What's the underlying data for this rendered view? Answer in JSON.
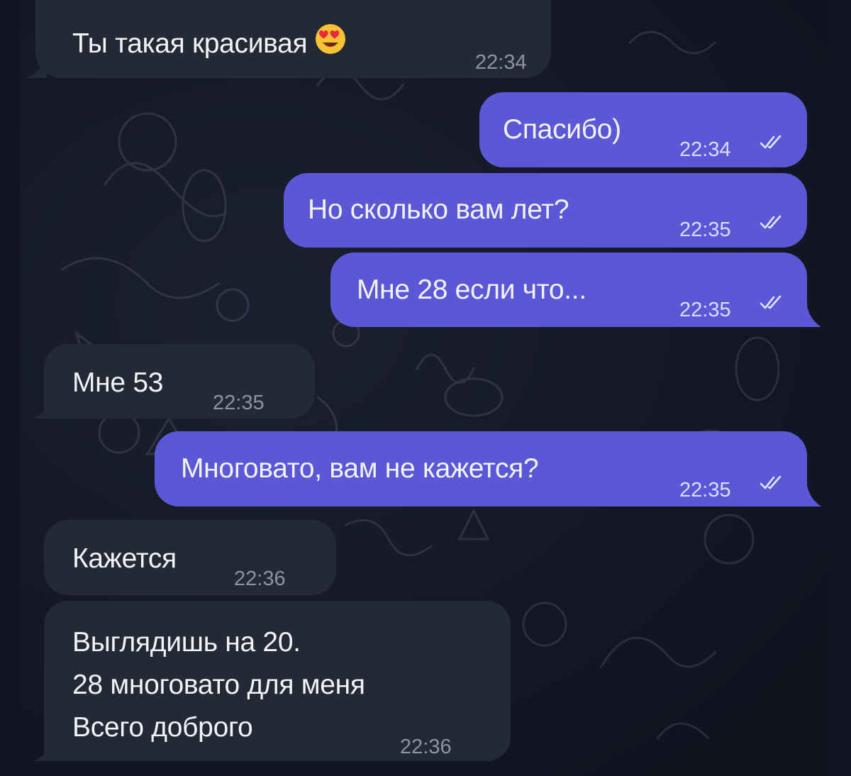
{
  "conversation": {
    "messages": [
      {
        "id": "m1",
        "direction": "incoming",
        "text": "Ты такая красивая",
        "emoji": "heart-eyes-emoji",
        "time": "22:34"
      },
      {
        "id": "m2",
        "direction": "outgoing",
        "text": "Спасибо)",
        "time": "22:34",
        "status": "read"
      },
      {
        "id": "m3",
        "direction": "outgoing",
        "text": "Но сколько вам лет?",
        "time": "22:35",
        "status": "read"
      },
      {
        "id": "m4",
        "direction": "outgoing",
        "text": "Мне 28 если что...",
        "time": "22:35",
        "status": "read"
      },
      {
        "id": "m5",
        "direction": "incoming",
        "text": "Мне 53",
        "time": "22:35"
      },
      {
        "id": "m6",
        "direction": "outgoing",
        "text": "Многовато, вам не кажется?",
        "time": "22:35",
        "status": "read"
      },
      {
        "id": "m7",
        "direction": "incoming",
        "text": "Кажется",
        "time": "22:36"
      },
      {
        "id": "m8",
        "direction": "incoming",
        "lines": [
          "Выглядишь на 20.",
          "28 многовато для меня",
          "Всего доброго"
        ],
        "time": "22:36"
      }
    ]
  },
  "colors": {
    "incoming_bubble": "#242936",
    "outgoing_bubble": "#5b58d8",
    "background": "#141826"
  }
}
